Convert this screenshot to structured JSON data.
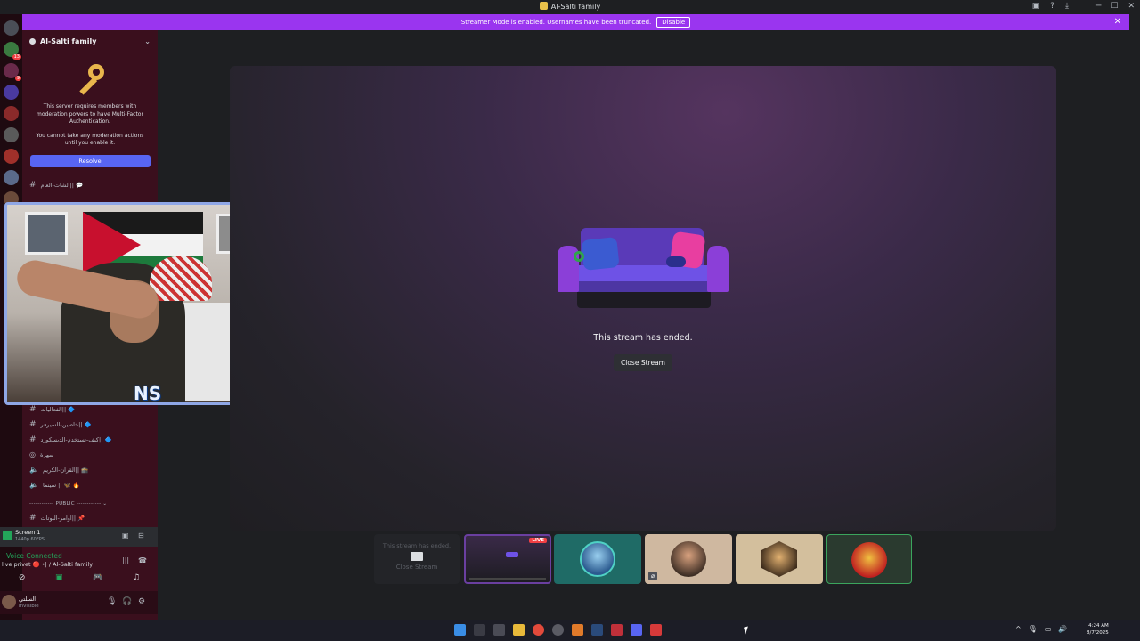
{
  "window": {
    "title": "Al-Salti family",
    "controls": [
      "─",
      "☐",
      "✕"
    ]
  },
  "streamer_banner": {
    "message": "Streamer Mode is enabled. Usernames have been truncated.",
    "disable_label": "Disable"
  },
  "server": {
    "name": "Al-Salti family",
    "mfa": {
      "line1": "This server requires members with moderation powers to have Multi-Factor Authentication.",
      "line2": "You cannot take any moderation actions until you enable it.",
      "resolve_label": "Resolve"
    }
  },
  "channels": {
    "top_channel": "الشات-العام|| 💬",
    "list": [
      "الفعاليات|| 🔷",
      "خاصين-السيرفر|| 🔷",
      "كيف-تستخدم-الديسكورد|| 🔷",
      "سهرة",
      "القران-الكريم|| 🕋",
      "سينما || 🦋 🔥"
    ],
    "category_public": "PUBLIC",
    "last_channel": "اوامر-البوتات|| 📌"
  },
  "overlay": {
    "logo_text": "NS"
  },
  "stream": {
    "ended_message": "This stream has ended.",
    "close_label": "Close Stream"
  },
  "tiles": {
    "ended_text": "This stream has ended.",
    "close_text": "Close Stream",
    "live_label": "LIVE"
  },
  "screen_share": {
    "name": "Screen 1",
    "sub": "1440p 60FPS"
  },
  "voice": {
    "status": "Voice Connected",
    "location": "live privet 🔴 •| / Al-Salti family"
  },
  "user": {
    "name": "السلتي",
    "status": "Invisible"
  },
  "taskbar": {
    "time": "4:24 AM",
    "date": "8/7/2025"
  },
  "colors": {
    "streamer_banner": "#9a35ef",
    "resolve_button": "#5865f2",
    "channel_panel": "#3a0f1d",
    "live_badge": "#f23f43",
    "voice_connected": "#23a55a"
  },
  "icons": [
    "discord-icon",
    "key-icon",
    "couch-illustration",
    "monitor-icon",
    "mic-icon",
    "headphones-icon",
    "gear-icon",
    "windows-start-icon",
    "search-icon"
  ]
}
